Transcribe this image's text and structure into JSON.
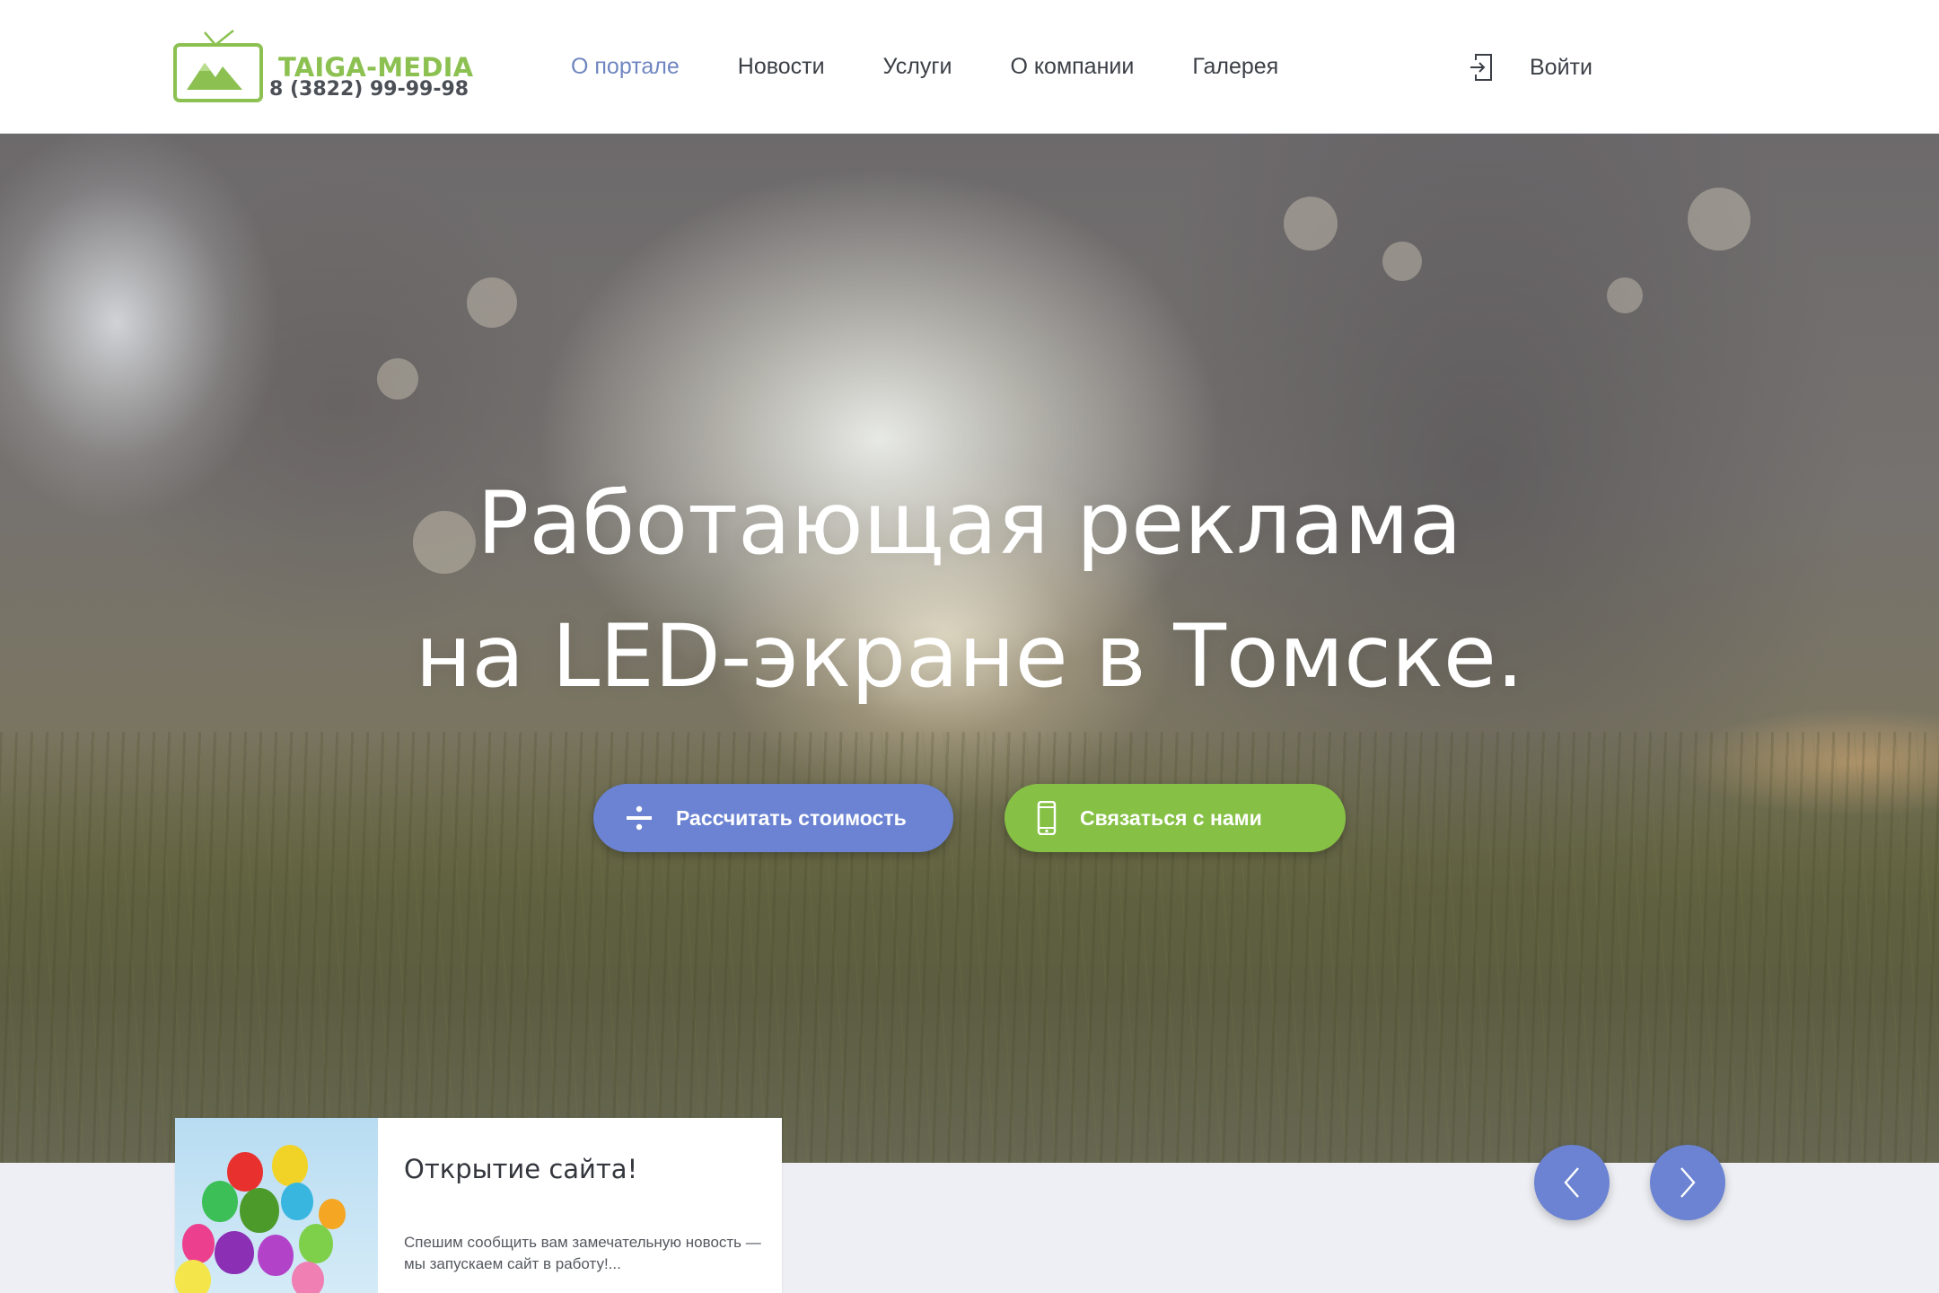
{
  "header": {
    "logo": {
      "name": "TAIGA-MEDIA",
      "phone": "8 (3822) 99-99-98"
    },
    "nav": [
      {
        "label": "О портале",
        "active": true
      },
      {
        "label": "Новости",
        "active": false
      },
      {
        "label": "Услуги",
        "active": false
      },
      {
        "label": "О компании",
        "active": false
      },
      {
        "label": "Галерея",
        "active": false
      }
    ],
    "login": {
      "label": "Войти",
      "icon": "login-icon"
    }
  },
  "hero": {
    "title_line1": "Работающая реклама",
    "title_line2": "на LED-экране в Томске.",
    "buttons": {
      "calculate": {
        "label": "Рассчитать стоимость",
        "icon": "divide-icon",
        "color": "#6b83d2"
      },
      "contact": {
        "label": "Связаться с нами",
        "icon": "smartphone-icon",
        "color": "#86c146"
      }
    }
  },
  "news": {
    "title": "Открытие сайта!",
    "text": "Спешим сообщить вам замечательную новость — мы запускаем сайт в работу!..."
  },
  "slider": {
    "prev_icon": "chevron-left-icon",
    "next_icon": "chevron-right-icon"
  },
  "colors": {
    "accent_blue": "#6b83d2",
    "accent_green": "#86c146",
    "logo_green": "#8cc152"
  }
}
